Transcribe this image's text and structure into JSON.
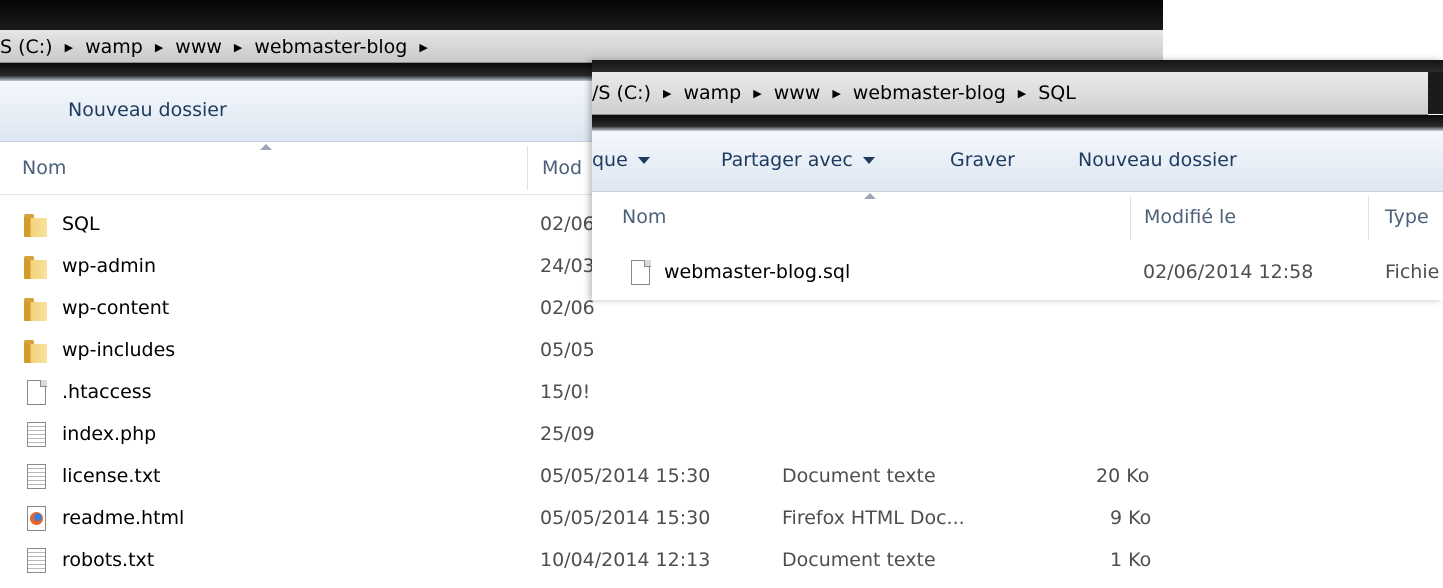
{
  "back_window": {
    "breadcrumb": [
      "S (C:)",
      "wamp",
      "www",
      "webmaster-blog"
    ],
    "toolbar": {
      "new_folder": "Nouveau dossier"
    },
    "columns": {
      "name": "Nom",
      "modified": "Mod"
    },
    "rows": [
      {
        "name": "SQL",
        "icon": "folder-icon",
        "modified": "02/06",
        "type": "",
        "size": ""
      },
      {
        "name": "wp-admin",
        "icon": "folder-icon",
        "modified": "24/03",
        "type": "",
        "size": ""
      },
      {
        "name": "wp-content",
        "icon": "folder-icon",
        "modified": "02/06",
        "type": "",
        "size": ""
      },
      {
        "name": "wp-includes",
        "icon": "folder-icon",
        "modified": "05/05",
        "type": "",
        "size": ""
      },
      {
        "name": ".htaccess",
        "icon": "file-icon",
        "modified": "15/0!",
        "type": "",
        "size": ""
      },
      {
        "name": "index.php",
        "icon": "text-file-icon",
        "modified": "25/09",
        "type": "",
        "size": ""
      },
      {
        "name": "license.txt",
        "icon": "text-file-icon",
        "modified": "05/05/2014 15:30",
        "type": "Document texte",
        "size": "20 Ko"
      },
      {
        "name": "readme.html",
        "icon": "firefox-icon",
        "modified": "05/05/2014 15:30",
        "type": "Firefox HTML Doc...",
        "size": "9 Ko"
      },
      {
        "name": "robots.txt",
        "icon": "text-file-icon",
        "modified": "10/04/2014 12:13",
        "type": "Document texte",
        "size": "1 Ko"
      }
    ]
  },
  "front_window": {
    "breadcrumb": [
      "/S (C:)",
      "wamp",
      "www",
      "webmaster-blog",
      "SQL"
    ],
    "toolbar": {
      "organize": "que",
      "share": "Partager avec",
      "burn": "Graver",
      "new_folder": "Nouveau dossier"
    },
    "columns": {
      "name": "Nom",
      "modified": "Modifié le",
      "type": "Type"
    },
    "rows": [
      {
        "name": "webmaster-blog.sql",
        "icon": "file-icon",
        "modified": "02/06/2014 12:58",
        "type": "Fichie"
      }
    ]
  }
}
